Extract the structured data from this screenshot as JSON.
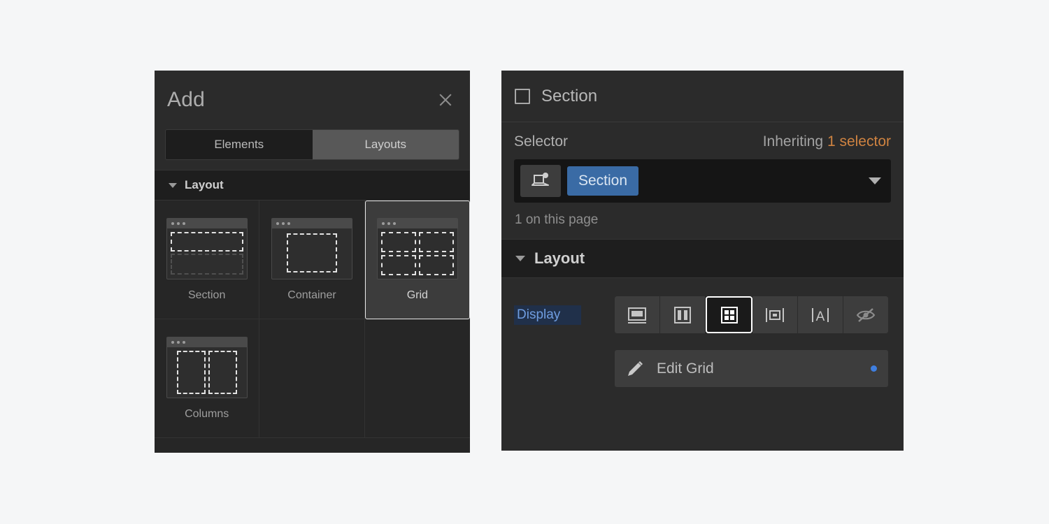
{
  "add_panel": {
    "title": "Add",
    "close_icon": "close-icon",
    "tabs": [
      {
        "label": "Elements",
        "active": true
      },
      {
        "label": "Layouts",
        "active": false
      }
    ],
    "section_header": {
      "label": "Layout",
      "caret": "chevron-down-icon",
      "expanded": true
    },
    "cards": [
      {
        "label": "Section",
        "icon": "section-thumbnail-icon",
        "selected": false
      },
      {
        "label": "Container",
        "icon": "container-thumbnail-icon",
        "selected": false
      },
      {
        "label": "Grid",
        "icon": "grid-thumbnail-icon",
        "selected": true
      },
      {
        "label": "Columns",
        "icon": "columns-thumbnail-icon",
        "selected": false
      }
    ]
  },
  "style_panel": {
    "header": {
      "title": "Section",
      "icon": "square-outline-icon"
    },
    "selector": {
      "label": "Selector",
      "inheriting_prefix": "Inheriting ",
      "inheriting_count": "1 selector",
      "device_icon": "desktop-device-icon",
      "chip_label": "Section",
      "dropdown_icon": "chevron-down-icon",
      "usage": "1 on this page"
    },
    "layout_section": {
      "label": "Layout",
      "caret": "chevron-down-icon",
      "expanded": true
    },
    "display": {
      "label": "Display",
      "options": [
        {
          "name": "display-block",
          "icon": "block-icon",
          "active": false
        },
        {
          "name": "display-flex",
          "icon": "flex-icon",
          "active": false
        },
        {
          "name": "display-grid",
          "icon": "grid-icon",
          "active": true
        },
        {
          "name": "display-inline-block",
          "icon": "inline-block-icon",
          "active": false
        },
        {
          "name": "display-inline",
          "icon": "inline-text-icon",
          "active": false
        },
        {
          "name": "display-none",
          "icon": "hidden-eye-icon",
          "active": false
        }
      ]
    },
    "edit_grid": {
      "label": "Edit Grid",
      "icon": "pencil-icon",
      "indicator": "blue-dot-indicator"
    }
  },
  "colors": {
    "page_background": "#f5f6f7",
    "panel_background": "#2b2b2b",
    "card_background": "#262626",
    "accent_blue": "#3a6ba5",
    "accent_amber": "#cf8341",
    "indicator_blue": "#3f7fe0",
    "selected_border": "#ffffff"
  }
}
